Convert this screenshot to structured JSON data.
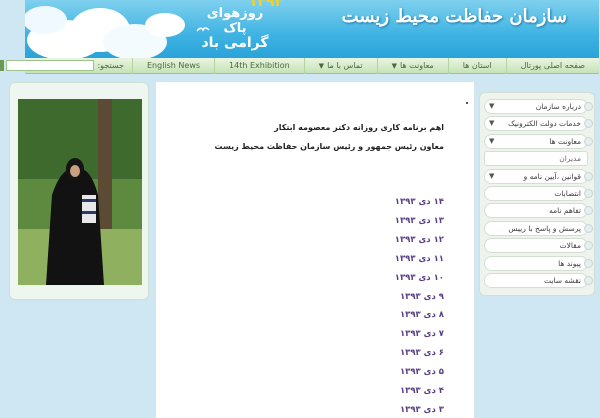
{
  "header": {
    "site_title": "سازمان حفاظت محیط زیست",
    "banner_year": "۱۳۹۳",
    "banner_line1": "روزهوای پاک",
    "banner_line2": "گرامی باد"
  },
  "nav": {
    "items": [
      {
        "label": "صفحه اصلی پورتال",
        "dropdown": false
      },
      {
        "label": "استان ها",
        "dropdown": false
      },
      {
        "label": "معاونت ها",
        "dropdown": true
      },
      {
        "label": "تماس با ما",
        "dropdown": true
      },
      {
        "label": "14th Exhibition",
        "dropdown": false
      },
      {
        "label": "English News",
        "dropdown": false
      }
    ],
    "search_label": "جستجو:",
    "search_placeholder": "",
    "search_button": "»"
  },
  "main": {
    "headline_1": "اهم برنامه کاری روزانه دکتر معصومه ابتکار",
    "headline_2": "معاون رئیس جمهور و رئیس سازمان حفاظت محیط زیست",
    "dates": [
      "۱۴ دی ۱۳۹۳",
      "۱۳ دی ۱۳۹۳",
      "۱۲ دی ۱۳۹۳",
      "۱۱ دی ۱۳۹۳",
      "۱۰ دی ۱۳۹۳",
      "۹ دی ۱۳۹۳",
      "۸ دی ۱۳۹۳",
      "۷ دی ۱۳۹۳",
      "۶ دی ۱۳۹۳",
      "۵ دی ۱۳۹۳",
      "۴ دی ۱۳۹۳",
      "۳ دی ۱۳۹۳"
    ]
  },
  "sidebar": {
    "items": [
      {
        "label": "درباره سازمان",
        "dropdown": true,
        "sub": false
      },
      {
        "label": "خدمات دولت الکترونیک",
        "dropdown": true,
        "sub": false
      },
      {
        "label": "معاونت ها",
        "dropdown": true,
        "sub": false
      },
      {
        "label": "مدیران",
        "dropdown": false,
        "sub": true
      },
      {
        "label": "قوانین ،آیین نامه و دستورالعمل",
        "dropdown": true,
        "sub": false
      },
      {
        "label": "انتصابات",
        "dropdown": false,
        "sub": false
      },
      {
        "label": "تفاهم نامه",
        "dropdown": false,
        "sub": false
      },
      {
        "label": "پرسش و پاسخ با رییس سازمان",
        "dropdown": false,
        "sub": false
      },
      {
        "label": "مقالات",
        "dropdown": false,
        "sub": false
      },
      {
        "label": "پیوند ها",
        "dropdown": false,
        "sub": false
      },
      {
        "label": "نقشه سایت",
        "dropdown": false,
        "sub": false
      }
    ]
  },
  "colors": {
    "header_blue": "#3fb3e3",
    "nav_green": "#c7e2b8",
    "date_link": "#5a3f86"
  }
}
